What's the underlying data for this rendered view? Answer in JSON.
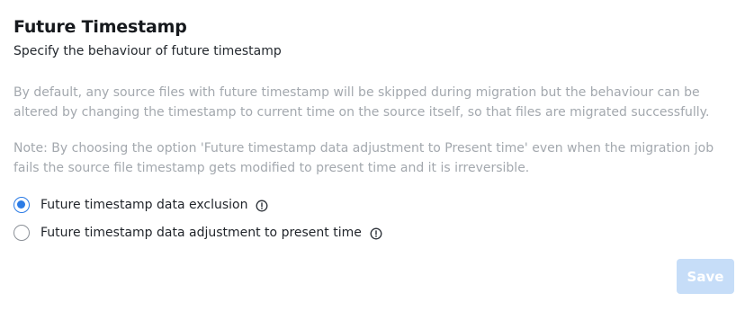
{
  "section": {
    "title": "Future Timestamp",
    "subtitle": "Specify the behaviour of future timestamp",
    "description": "By default, any source files with future timestamp will be skipped during migration but the behaviour can be altered by changing the timestamp to current time on the source itself, so that files are migrated successfully.",
    "note": "Note: By choosing the option 'Future timestamp data adjustment to Present time' even when the migration job fails the source file timestamp gets modified to present time and it is irreversible."
  },
  "options": [
    {
      "label": "Future timestamp data exclusion",
      "selected": true,
      "icon": "info-icon"
    },
    {
      "label": "Future timestamp data adjustment to present time",
      "selected": false,
      "icon": "info-icon"
    }
  ],
  "actions": {
    "save_label": "Save",
    "save_enabled": false
  },
  "colors": {
    "accent": "#2b7be5",
    "save_disabled_bg": "#c6ddf8",
    "muted_text": "#a3a8ae"
  }
}
